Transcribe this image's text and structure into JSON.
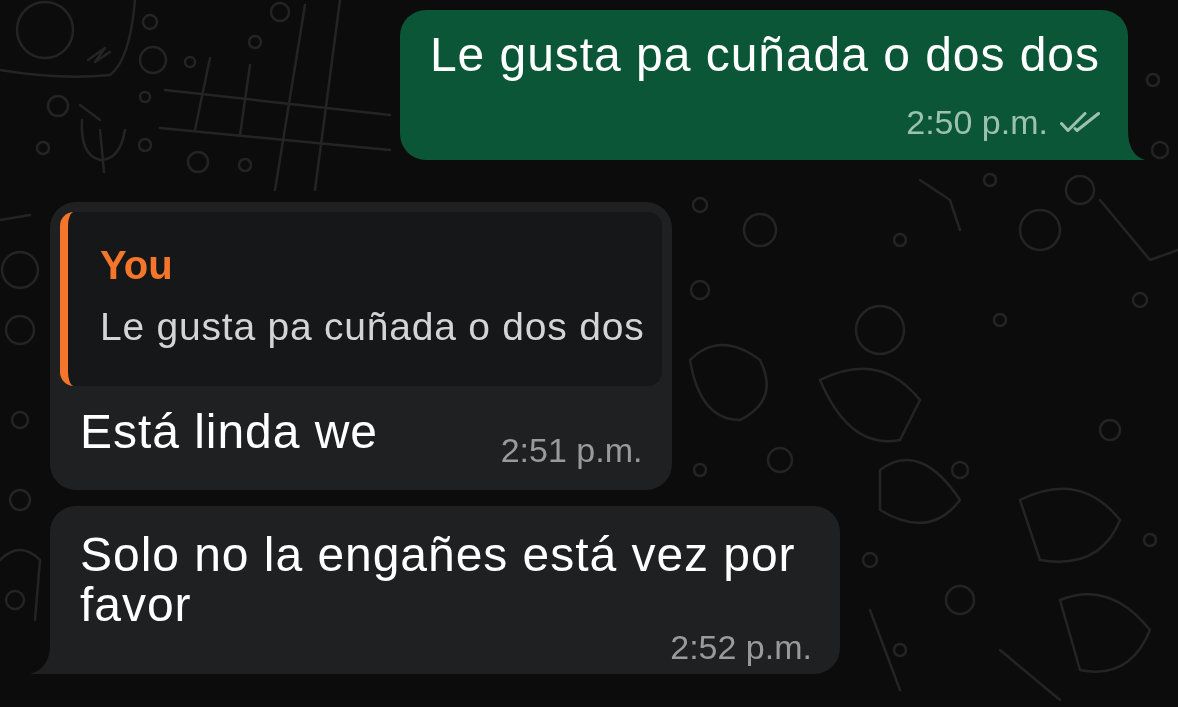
{
  "messages": [
    {
      "kind": "sent",
      "text": "Le gusta pa cuñada o dos dos",
      "time": "2:50 p.m.",
      "read": false,
      "tail": true
    },
    {
      "kind": "received",
      "quote": {
        "author": "You",
        "text": "Le gusta pa cuñada o dos dos"
      },
      "text": "Está linda we",
      "time": "2:51 p.m.",
      "tail": false
    },
    {
      "kind": "received",
      "text": "Solo no la engañes está vez por favor",
      "time": "2:52 p.m.",
      "tail": true
    }
  ]
}
